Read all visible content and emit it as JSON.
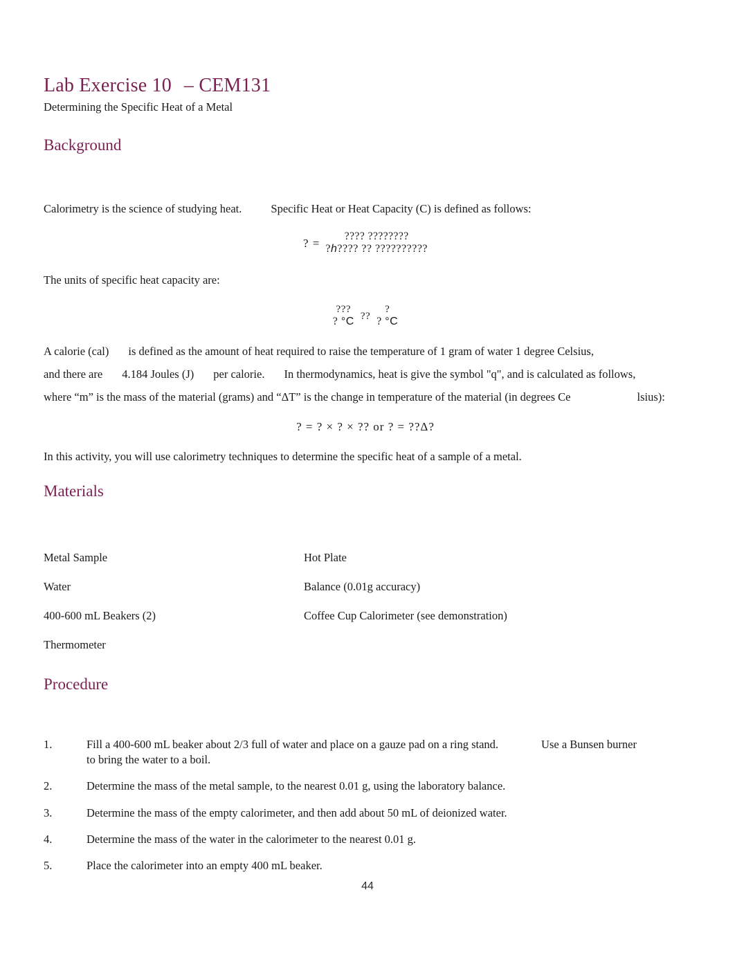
{
  "document": {
    "title_main": "Lab Exercise 10",
    "title_dash": "– CEM131",
    "subtitle": "Determining the Specific Heat of a Metal",
    "page_number": "44",
    "heading_color": "#7A1F52",
    "body_color": "#1a1a1a"
  },
  "background": {
    "heading": "Background",
    "intro_sentence_1": "Calorimetry is the science of studying heat.",
    "intro_sentence_2": "Specific Heat or Heat Capacity (C) is defined as follows:",
    "equation_c": {
      "lhs": "?  =",
      "numerator": "???? ????????",
      "denominator_prefix": "?",
      "denominator_italic": "h",
      "denominator_suffix": "???? ?? ??????????"
    },
    "units_lead": "The units of specific heat capacity are:",
    "equation_units": {
      "left_num": "???",
      "left_den_value": "?",
      "left_den_unit": "°C",
      "operator": "??",
      "right_num": "?",
      "right_den_value": "?",
      "right_den_unit": "°C"
    },
    "calorie_line_1": "A calorie (cal)",
    "calorie_line_1b": "is defined as the amount of heat required to raise the temperature of 1 gram of water 1 degree Celsius,",
    "calorie_line_2a": "and there are",
    "calorie_line_2b": "4.184 Joules (J)",
    "calorie_line_2c": "per calorie.",
    "calorie_line_2d": "In thermodynamics, heat is give the symbol \"q\", and is calculated as follows,",
    "calorie_line_3a": "where “m” is the mass of the material (grams) and “ΔT” is the change in temperature of the material (in degrees Ce",
    "calorie_line_3b": "lsius):",
    "equation_q": "? = ? × ? × ?? or ? = ??Δ?",
    "closing": "In this activity, you will use calorimetry techniques to determine the specific heat of a sample of a metal."
  },
  "materials": {
    "heading": "Materials",
    "rows": [
      {
        "left": "Metal Sample",
        "right": "Hot Plate"
      },
      {
        "left": "Water",
        "right": "Balance (0.01g accuracy)"
      },
      {
        "left": "400-600 mL Beakers (2)",
        "right": "Coffee Cup Calorimeter (see demonstration)"
      },
      {
        "left": "Thermometer",
        "right": ""
      }
    ]
  },
  "procedure": {
    "heading": "Procedure",
    "items": [
      {
        "number": "1.",
        "text_a": "Fill a 400-600 mL beaker about 2/3 full of water and place on a gauze pad on a ring stand.",
        "text_b": "Use a Bunsen burner",
        "text_c": "to bring the water to a boil."
      },
      {
        "number": "2.",
        "text_a": "Determine the mass of the metal sample, to the nearest 0.01 g, using the laboratory balance."
      },
      {
        "number": "3.",
        "text_a": "Determine the mass of the empty calorimeter, and then add about 50 mL of deionized water."
      },
      {
        "number": "4.",
        "text_a": "Determine the mass of the water in the calorimeter to the nearest 0.01 g."
      },
      {
        "number": "5.",
        "text_a": "Place the calorimeter into an empty 400 mL beaker."
      }
    ]
  }
}
